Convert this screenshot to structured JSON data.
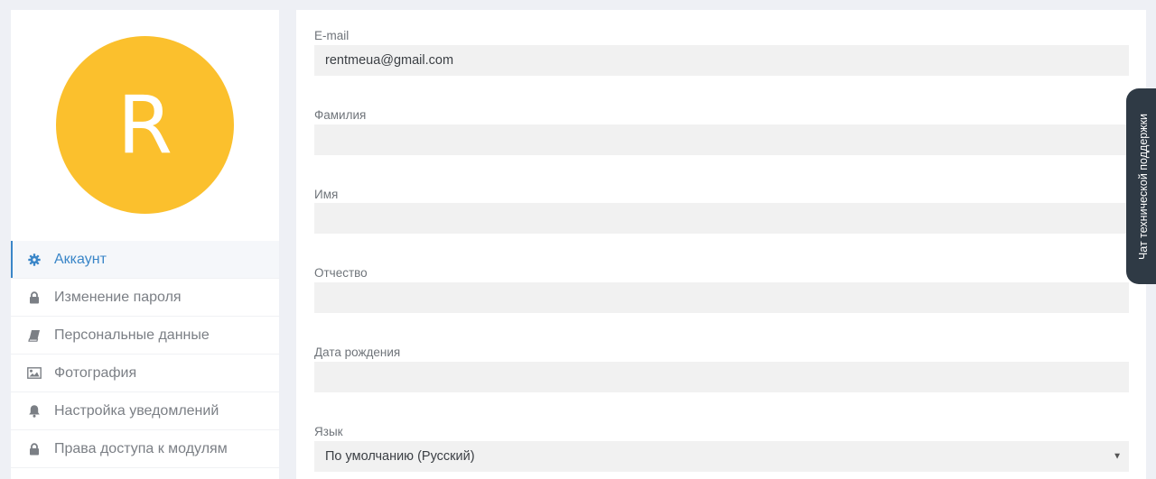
{
  "profile": {
    "avatar_letter": "R",
    "avatar_color": "#fbc02d"
  },
  "sidebar": {
    "items": [
      {
        "label": "Аккаунт",
        "icon": "gear-icon",
        "active": true
      },
      {
        "label": "Изменение пароля",
        "icon": "lock-icon",
        "active": false
      },
      {
        "label": "Персональные данные",
        "icon": "book-icon",
        "active": false
      },
      {
        "label": "Фотография",
        "icon": "picture-icon",
        "active": false
      },
      {
        "label": "Настройка уведомлений",
        "icon": "bell-icon",
        "active": false
      },
      {
        "label": "Права доступа к модулям",
        "icon": "lock-icon",
        "active": false
      }
    ]
  },
  "form": {
    "email": {
      "label": "E-mail",
      "value": "rentmeua@gmail.com"
    },
    "last_name": {
      "label": "Фамилия",
      "value": ""
    },
    "first_name": {
      "label": "Имя",
      "value": ""
    },
    "patronymic": {
      "label": "Отчество",
      "value": ""
    },
    "birth_date": {
      "label": "Дата рождения",
      "value": ""
    },
    "language": {
      "label": "Язык",
      "value": "По умолчанию (Русский)"
    }
  },
  "support": {
    "label": "Чат технической поддержки"
  },
  "colors": {
    "accent": "#3a86c8",
    "support_bg": "#2f3a45"
  }
}
